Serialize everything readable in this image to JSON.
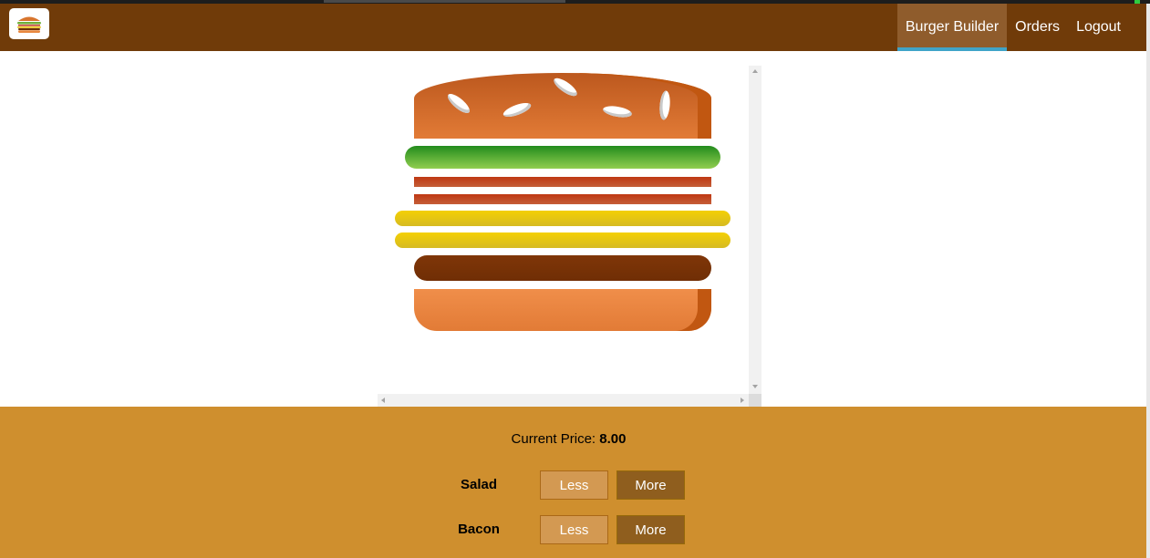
{
  "nav": {
    "items": [
      {
        "label": "Burger Builder",
        "active": true
      },
      {
        "label": "Orders",
        "active": false
      },
      {
        "label": "Logout",
        "active": false
      }
    ]
  },
  "logo": {
    "icon": "burger-logo-icon"
  },
  "price": {
    "label": "Current Price:",
    "value": "8.00"
  },
  "ingredients": [
    {
      "label": "Salad",
      "less": "Less",
      "more": "More"
    },
    {
      "label": "Bacon",
      "less": "Less",
      "more": "More"
    }
  ],
  "colors": {
    "toolbar": "#703b09",
    "controls_bg": "#cf8f2e",
    "active_underline": "#40a4c8",
    "more_button": "#8f5e1e",
    "less_button": "#d39952"
  }
}
